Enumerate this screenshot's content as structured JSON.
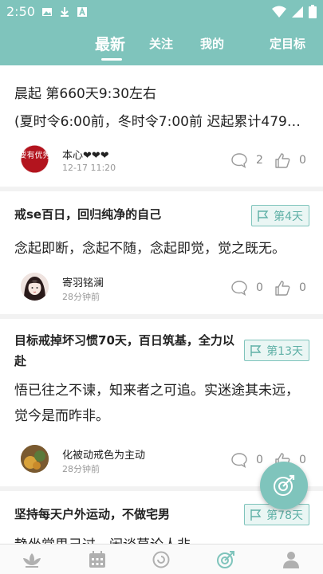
{
  "status_bar": {
    "time": "2:50",
    "icons": [
      "image-icon",
      "download-icon",
      "font-icon",
      "wifi-icon",
      "signal-icon",
      "battery-icon"
    ]
  },
  "top_nav": {
    "tabs": [
      {
        "label": "最新",
        "active": true
      },
      {
        "label": "关注",
        "active": false
      },
      {
        "label": "我的",
        "active": false
      }
    ],
    "action_label": "定目标"
  },
  "posts": [
    {
      "title": "晨起 第660天9:30左右",
      "body": "(夏时令6:00前，冬时令7:00前 迟起累计479…",
      "author": "本心❤❤❤",
      "time": "12-17 11:20",
      "comments": "2",
      "likes": "0",
      "avatar_text": "要有优秀"
    },
    {
      "title": "戒se百日，回归纯净的自己",
      "badge": "第4天",
      "body": "念起即断，念起不随，念起即觉，觉之既无。",
      "author": "寄羽铭澜",
      "time": "28分钟前",
      "comments": "0",
      "likes": "0"
    },
    {
      "title": "目标戒掉坏习惯70天，百日筑基，全力以赴",
      "badge": "第13天",
      "body": "悟已往之不谏，知来者之可追。实迷途其未远，觉今是而昨非。",
      "author": "化被动戒色为主动",
      "time": "28分钟前",
      "comments": "0",
      "likes": "0"
    },
    {
      "title": "坚持每天户外运动，不做宅男",
      "badge": "第78天",
      "body": "静坐常思己过，闲谈莫论人非"
    }
  ],
  "bottom_nav": [
    "lotus-icon",
    "calendar-icon",
    "target-icon",
    "goal-icon",
    "profile-icon"
  ],
  "colors": {
    "accent": "#7fc4bc",
    "badge_text": "#5fb0a6",
    "background": "#f2f2f2"
  }
}
